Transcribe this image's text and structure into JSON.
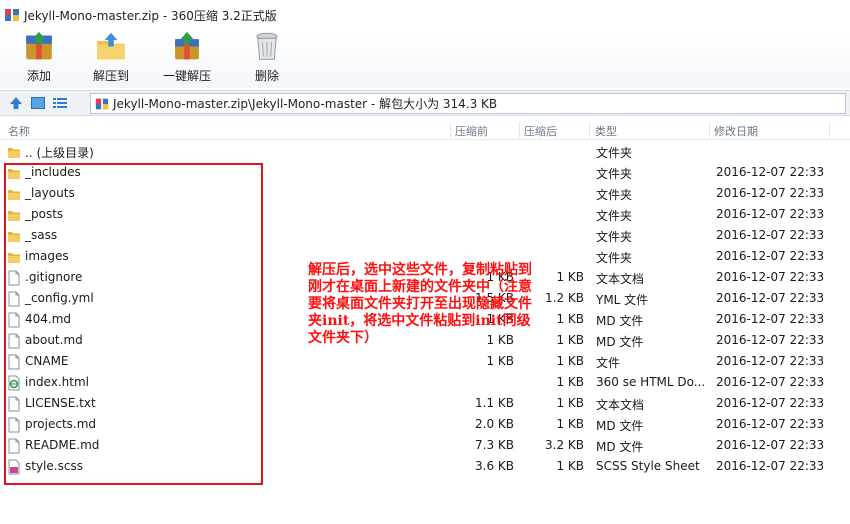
{
  "window": {
    "title": "Jekyll-Mono-master.zip - 360压缩 3.2正式版"
  },
  "toolbar": [
    {
      "label": "添加",
      "icon": "add-archive-icon"
    },
    {
      "label": "解压到",
      "icon": "extract-to-icon"
    },
    {
      "label": "一键解压",
      "icon": "one-click-extract-icon"
    },
    {
      "label": "删除",
      "icon": "trash-icon"
    }
  ],
  "address": {
    "path": "Jekyll-Mono-master.zip\\Jekyll-Mono-master - 解包大小为 314.3 KB"
  },
  "columns": {
    "name": "名称",
    "size": "压缩前",
    "packed": "压缩后",
    "type": "类型",
    "modified": "修改日期"
  },
  "files": [
    {
      "name": ".. (上级目录)",
      "size": "",
      "packed": "",
      "type": "文件夹",
      "date": "",
      "icon": "folder-icon"
    },
    {
      "name": "_includes",
      "size": "",
      "packed": "",
      "type": "文件夹",
      "date": "2016-12-07 22:33",
      "icon": "folder-icon"
    },
    {
      "name": "_layouts",
      "size": "",
      "packed": "",
      "type": "文件夹",
      "date": "2016-12-07 22:33",
      "icon": "folder-icon"
    },
    {
      "name": "_posts",
      "size": "",
      "packed": "",
      "type": "文件夹",
      "date": "2016-12-07 22:33",
      "icon": "folder-icon"
    },
    {
      "name": "_sass",
      "size": "",
      "packed": "",
      "type": "文件夹",
      "date": "2016-12-07 22:33",
      "icon": "folder-icon"
    },
    {
      "name": "images",
      "size": "",
      "packed": "",
      "type": "文件夹",
      "date": "2016-12-07 22:33",
      "icon": "folder-icon"
    },
    {
      "name": ".gitignore",
      "size": "1 KB",
      "packed": "1 KB",
      "type": "文本文档",
      "date": "2016-12-07 22:33",
      "icon": "file-icon"
    },
    {
      "name": "_config.yml",
      "size": "1.5 KB",
      "packed": "1.2 KB",
      "type": "YML 文件",
      "date": "2016-12-07 22:33",
      "icon": "file-icon"
    },
    {
      "name": "404.md",
      "size": "1 KB",
      "packed": "1 KB",
      "type": "MD 文件",
      "date": "2016-12-07 22:33",
      "icon": "file-icon"
    },
    {
      "name": "about.md",
      "size": "1 KB",
      "packed": "1 KB",
      "type": "MD 文件",
      "date": "2016-12-07 22:33",
      "icon": "file-icon"
    },
    {
      "name": "CNAME",
      "size": "1 KB",
      "packed": "1 KB",
      "type": "文件",
      "date": "2016-12-07 22:33",
      "icon": "file-icon"
    },
    {
      "name": "index.html",
      "size": "",
      "packed": "1 KB",
      "type": "360 se HTML Do...",
      "date": "2016-12-07 22:33",
      "icon": "html-file-icon"
    },
    {
      "name": "LICENSE.txt",
      "size": "1.1 KB",
      "packed": "1 KB",
      "type": "文本文档",
      "date": "2016-12-07 22:33",
      "icon": "file-icon"
    },
    {
      "name": "projects.md",
      "size": "2.0 KB",
      "packed": "1 KB",
      "type": "MD 文件",
      "date": "2016-12-07 22:33",
      "icon": "file-icon"
    },
    {
      "name": "README.md",
      "size": "7.3 KB",
      "packed": "3.2 KB",
      "type": "MD 文件",
      "date": "2016-12-07 22:33",
      "icon": "file-icon"
    },
    {
      "name": "style.scss",
      "size": "3.6 KB",
      "packed": "1 KB",
      "type": "SCSS Style Sheet",
      "date": "2016-12-07 22:33",
      "icon": "scss-file-icon"
    }
  ],
  "annotation": {
    "text": "解压后，选中这些文件，复制粘贴到刚才在桌面上新建的文件夹中（注意要将桌面文件夹打开至出现隐藏文件夹init，将选中文件粘贴到init同级文件夹下）"
  },
  "colors": {
    "annotation": "#ff1010",
    "highlight_box": "#e0141e",
    "folder": "#e8b33a"
  }
}
